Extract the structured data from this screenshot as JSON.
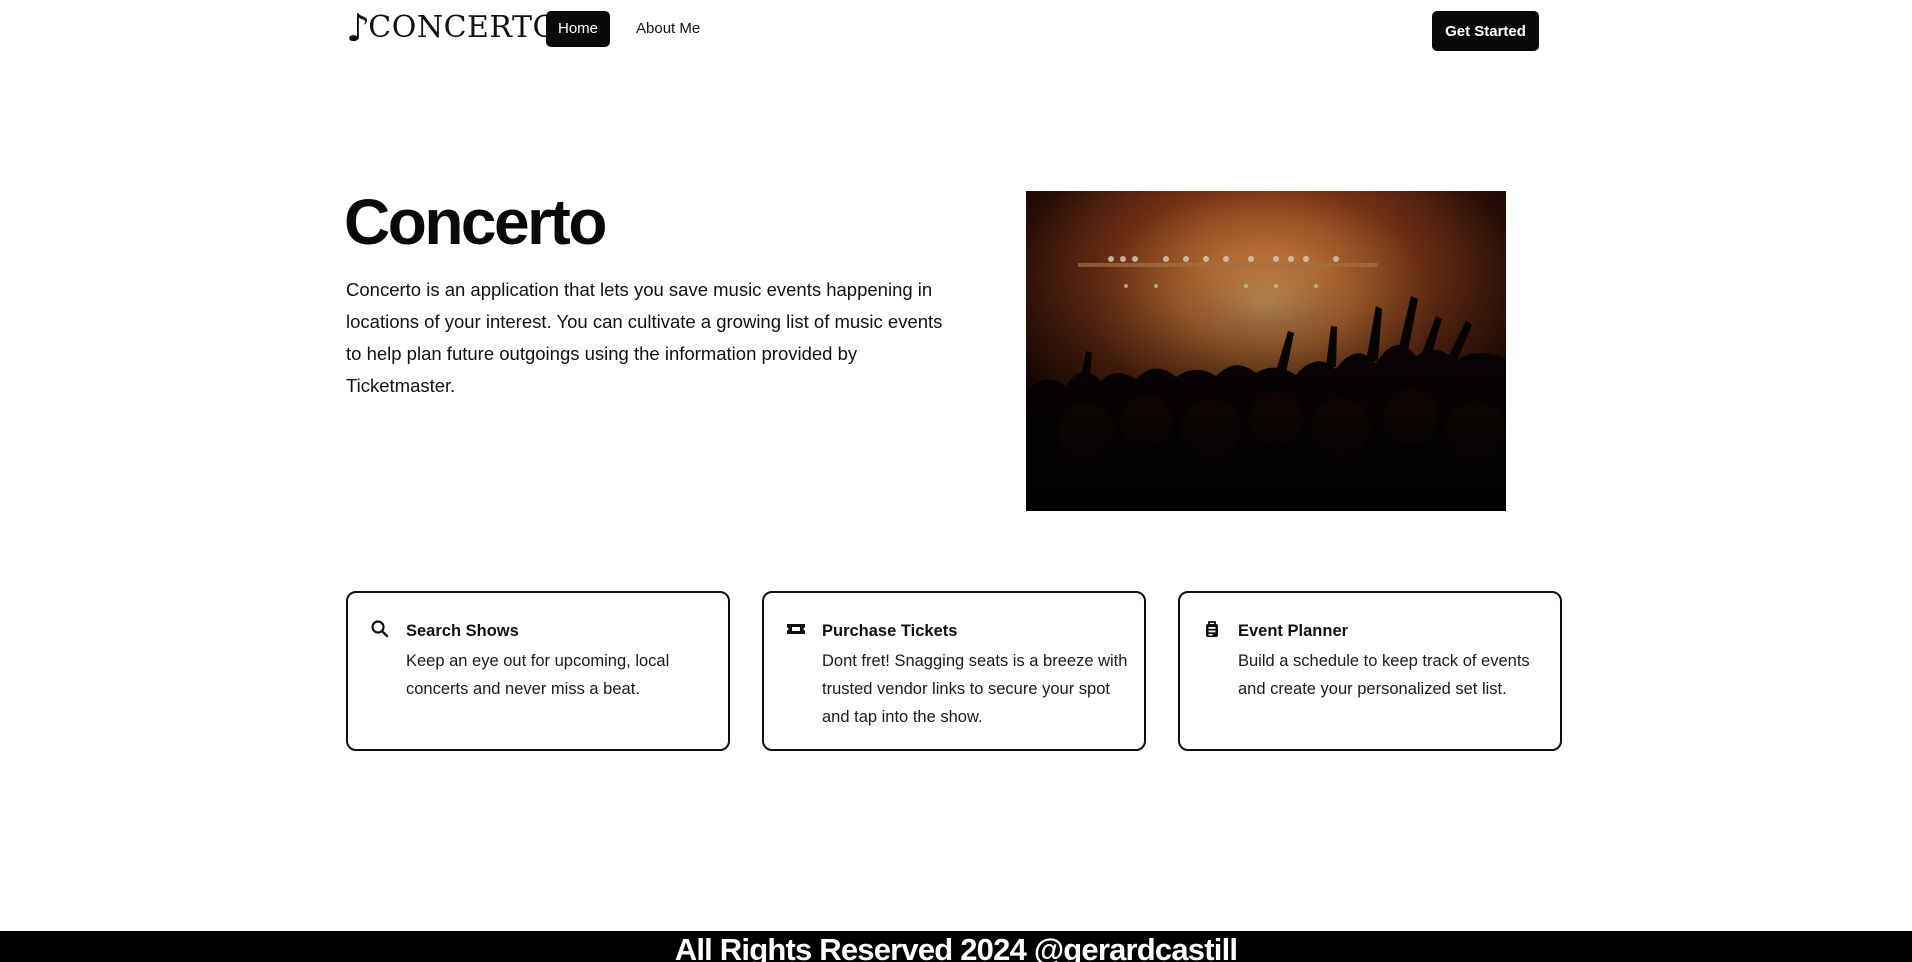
{
  "header": {
    "logo_text": "CONCERTO",
    "nav": [
      {
        "label": "Home",
        "active": true
      },
      {
        "label": "About Me",
        "active": false
      }
    ],
    "cta_label": "Get Started"
  },
  "hero": {
    "title": "Concerto",
    "description": "Concerto is an application that lets you save music events happening in locations of your interest. You can cultivate a growing list of music events to help plan future outgoings using the information provided by Ticketmaster.",
    "image": "concert-crowd-stage-photo"
  },
  "features": [
    {
      "icon": "search-icon",
      "title": "Search Shows",
      "description": "Keep an eye out for upcoming, local concerts and never miss a beat."
    },
    {
      "icon": "ticket-icon",
      "title": "Purchase Tickets",
      "description": "Dont fret! Snagging seats is a breeze with trusted vendor links to secure your spot and tap into the show."
    },
    {
      "icon": "planner-icon",
      "title": "Event Planner",
      "description": "Build a schedule to keep track of events and create your personalized set list."
    }
  ],
  "footer": {
    "text": "All Rights Reserved 2024 @gerardcastill"
  },
  "colors": {
    "primary": "#0a0a0a",
    "background": "#ffffff",
    "footer_bg": "#000000"
  }
}
